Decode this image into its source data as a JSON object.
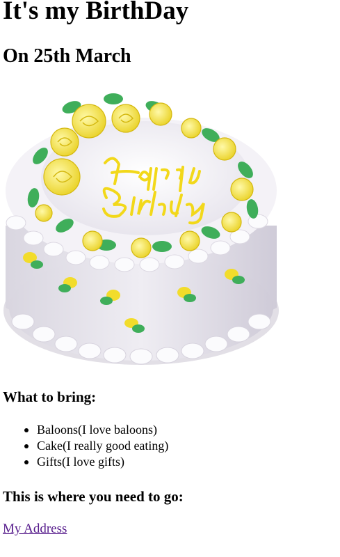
{
  "header": {
    "title": "It's my BirthDay",
    "subtitle": "On 25th March"
  },
  "image": {
    "cake_inscription_line1": "Happy",
    "cake_inscription_line2": "Birthday"
  },
  "bring_section": {
    "heading": "What to bring:",
    "items": [
      "Baloons(I love baloons)",
      "Cake(I really good eating)",
      "Gifts(I love gifts)"
    ]
  },
  "location_section": {
    "heading": "This is where you need to go:",
    "link_label": "My Address"
  },
  "colors": {
    "link": "#551a8b",
    "frosting": "#f4f2f7",
    "rose": "#f5e63c",
    "leaf": "#3fae5a"
  }
}
